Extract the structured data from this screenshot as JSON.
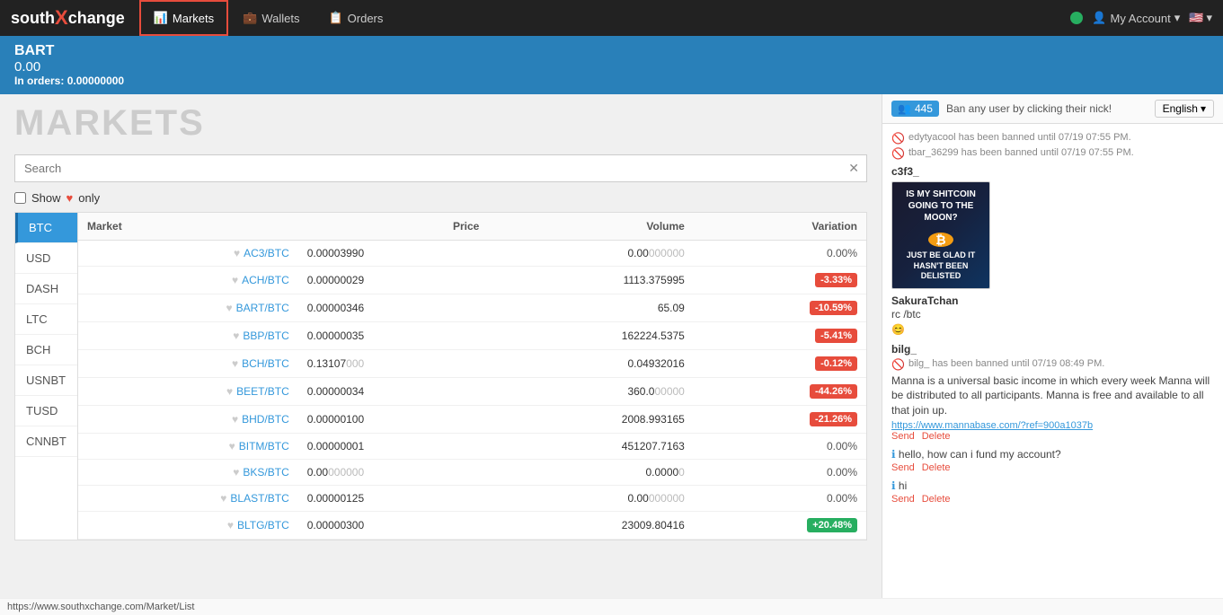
{
  "brand": {
    "south": "south",
    "x": "X",
    "change": "change"
  },
  "navbar": {
    "markets_label": "Markets",
    "wallets_label": "Wallets",
    "orders_label": "Orders",
    "my_account_label": "My Account",
    "language": "English"
  },
  "coin_header": {
    "name": "BART",
    "value": "0.00",
    "orders_label": "In orders:",
    "orders_value": "0.00000000"
  },
  "markets": {
    "title": "MARKETS",
    "search_placeholder": "Search",
    "show_fav_label": "Show",
    "only_label": "only",
    "tabs": [
      {
        "id": "btc",
        "label": "BTC",
        "active": true
      },
      {
        "id": "usd",
        "label": "USD",
        "active": false
      },
      {
        "id": "dash",
        "label": "DASH",
        "active": false
      },
      {
        "id": "ltc",
        "label": "LTC",
        "active": false
      },
      {
        "id": "bch",
        "label": "BCH",
        "active": false
      },
      {
        "id": "usnbt",
        "label": "USNBT",
        "active": false
      },
      {
        "id": "tusd",
        "label": "TUSD",
        "active": false
      },
      {
        "id": "cnnbt",
        "label": "CNNBT",
        "active": false
      }
    ],
    "table_headers": {
      "market": "Market",
      "price": "Price",
      "volume": "Volume",
      "variation": "Variation"
    },
    "rows": [
      {
        "market": "AC3/BTC",
        "price": "0.00003990",
        "price_dim": "",
        "volume": "0.00",
        "volume_dim": "000000",
        "variation": "0.00%",
        "var_type": "neutral",
        "fav": false
      },
      {
        "market": "ACH/BTC",
        "price": "0.00000029",
        "price_dim": "",
        "volume": "1113.375995",
        "volume_dim": "",
        "variation": "-3.33%",
        "var_type": "neg",
        "fav": false
      },
      {
        "market": "BART/BTC",
        "price": "0.00000346",
        "price_dim": "",
        "volume": "65.09",
        "volume_dim": "",
        "variation": "-10.59%",
        "var_type": "neg",
        "fav": false
      },
      {
        "market": "BBP/BTC",
        "price": "0.00000035",
        "price_dim": "",
        "volume": "162224.5375",
        "volume_dim": "",
        "variation": "-5.41%",
        "var_type": "neg",
        "fav": false
      },
      {
        "market": "BCH/BTC",
        "price": "0.13107",
        "price_dim": "000",
        "volume": "0.04932016",
        "volume_dim": "",
        "variation": "-0.12%",
        "var_type": "neg",
        "fav": false
      },
      {
        "market": "BEET/BTC",
        "price": "0.00000034",
        "price_dim": "",
        "volume": "360.0",
        "volume_dim": "00000",
        "variation": "-44.26%",
        "var_type": "neg",
        "fav": false
      },
      {
        "market": "BHD/BTC",
        "price": "0.00000100",
        "price_dim": "",
        "volume": "2008.993165",
        "volume_dim": "",
        "variation": "-21.26%",
        "var_type": "neg",
        "fav": false
      },
      {
        "market": "BITM/BTC",
        "price": "0.00000001",
        "price_dim": "",
        "volume": "451207.7163",
        "volume_dim": "",
        "variation": "0.00%",
        "var_type": "neutral",
        "fav": false
      },
      {
        "market": "BKS/BTC",
        "price": "0.00",
        "price_dim": "000000",
        "volume": "0.0000",
        "volume_dim": "0",
        "variation": "0.00%",
        "var_type": "neutral",
        "fav": false
      },
      {
        "market": "BLAST/BTC",
        "price": "0.00000125",
        "price_dim": "",
        "volume": "0.00",
        "volume_dim": "000000",
        "variation": "0.00%",
        "var_type": "neutral",
        "fav": false
      },
      {
        "market": "BLTG/BTC",
        "price": "0.00000300",
        "price_dim": "",
        "volume": "23009.80416",
        "volume_dim": "",
        "variation": "+20.48%",
        "var_type": "pos",
        "fav": false
      }
    ]
  },
  "chat": {
    "users_count": "445",
    "ban_message": "Ban any user by clicking their nick!",
    "language": "English",
    "ban_notices": [
      "edytyacool has been banned until 07/19 07:55 PM.",
      "tbar_36299 has been banned until 07/19 07:55 PM."
    ],
    "messages": [
      {
        "type": "username_msg",
        "username": "c3f3_",
        "has_image": true,
        "image_text_top": "IS MY SHITCOIN GOING TO THE MOON?",
        "image_text_bottom": "JUST BE GLAD IT HASN'T BEEN DELISTED",
        "has_coin": true
      },
      {
        "type": "text_msg",
        "username": "SakuraTchan",
        "text": "rc /btc",
        "emoji": "😊"
      },
      {
        "type": "text_msg",
        "username": "bilg_",
        "ban_notice": "bilg_ has been banned until 07/19 08:49 PM.",
        "text": "Manna is a universal basic income in which every week Manna will be distributed to all participants. Manna is free and available to all that join up.",
        "link": "https://www.mannabase.com/?ref=900a1037b",
        "actions": [
          "Send",
          "Delete"
        ]
      },
      {
        "type": "text_simple",
        "text": "hello, how can i fund my account?",
        "actions": [
          "Send",
          "Delete"
        ]
      },
      {
        "type": "text_simple2",
        "text": "hi",
        "actions": [
          "Send",
          "Delete"
        ]
      }
    ]
  },
  "footer": {
    "url": "https://www.southxchange.com/Market/List"
  }
}
